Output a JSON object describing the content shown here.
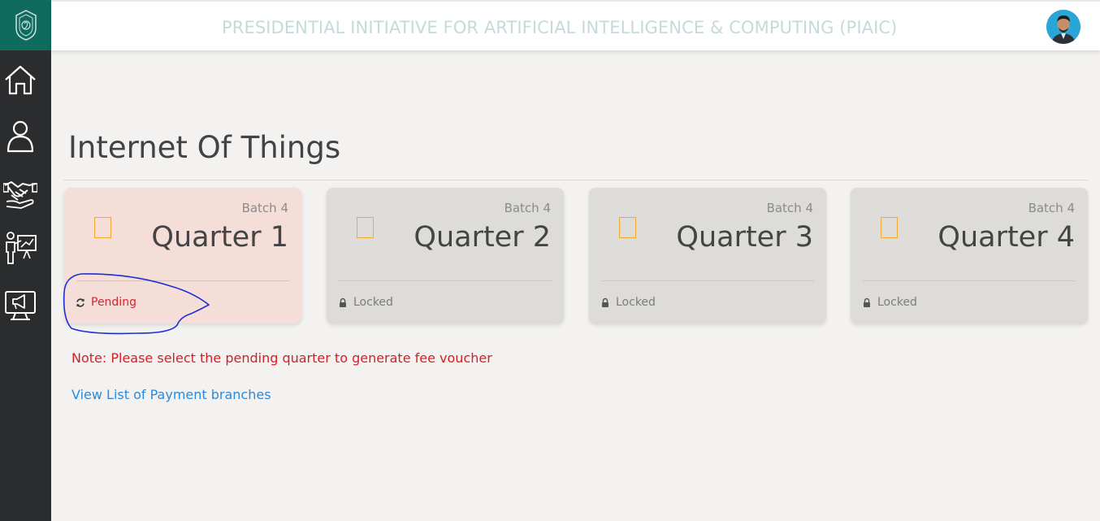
{
  "header": {
    "title": "PRESIDENTIAL INITIATIVE FOR ARTIFICIAL INTELLIGENCE & COMPUTING (PIAIC)"
  },
  "sidebar": {
    "logo": "piaic-logo",
    "items": [
      {
        "icon": "home-icon"
      },
      {
        "icon": "user-icon"
      },
      {
        "icon": "handshake-icon"
      },
      {
        "icon": "presentation-icon"
      },
      {
        "icon": "announcement-monitor-icon"
      }
    ]
  },
  "main": {
    "title": "Internet Of Things",
    "quarters": [
      {
        "batch": "Batch 4",
        "name": "Quarter 1",
        "status": "Pending",
        "status_icon": "refresh-icon"
      },
      {
        "batch": "Batch 4",
        "name": "Quarter 2",
        "status": "Locked",
        "status_icon": "lock-icon"
      },
      {
        "batch": "Batch 4",
        "name": "Quarter 3",
        "status": "Locked",
        "status_icon": "lock-icon"
      },
      {
        "batch": "Batch 4",
        "name": "Quarter 4",
        "status": "Locked",
        "status_icon": "lock-icon"
      }
    ],
    "note": "Note: Please select the pending quarter to generate fee voucher",
    "link": "View List of Payment branches"
  },
  "colors": {
    "sidebar": "#2b2c2e",
    "logo_bg": "#0f6b5e",
    "pending_card": "#f5ddd8",
    "locked_card": "#dedcd9",
    "note": "#d41f24",
    "link": "#2e8ad8",
    "checkbox_border": "#f0a92c"
  }
}
